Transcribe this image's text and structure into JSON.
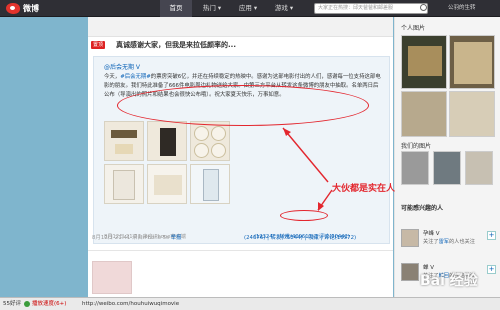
{
  "topbar": {
    "logo_text": "微博",
    "nav": [
      "首页",
      "热门 ▾",
      "应用 ▾",
      "游戏 ▾"
    ],
    "search_placeholder": "大家正在热搜：邱天爸爸和邮差服",
    "user_label": "公羽的生转"
  },
  "post": {
    "badge": "置顶",
    "title": "真诚感谢大家，但我是来拉低颜率的...",
    "quote": {
      "author": "@后会无期 V",
      "body_parts": [
        {
          "text": "今天，",
          "style": "plain"
        },
        {
          "text": "#后会无期#",
          "style": "lnk"
        },
        {
          "text": "的票房突破6亿，并还在持续稳定的热映中。感谢为这部电影付出的人们，感谢每一位支持这部电影的朋友。我们特此准备了666件电影周边礼物送给大家。由第三方平台从转发这条微博的朋友中抽取。名单两日后公布（导演出的照片和结果也会很快公布哦）。祝大家夏天快乐，万事如意。",
          "style": "plain"
        }
      ],
      "meta": "8月12日 21:31  来自iPhone客户端",
      "stats": "(12324) | 转发(409613) | 评论(90442)"
    },
    "meta": {
      "time": "8月12日 21:41",
      "source": "来自iPhone 5s",
      "report": "举报"
    },
    "stats": "(24076) | 转发(75544) | 收藏 | 评论(19572)"
  },
  "annotation": {
    "text": "大伙都是实在人"
  },
  "sidebar": {
    "photos_title": "个人图片",
    "related_title": "我们的图片",
    "interest_title": "可能感兴趣的人",
    "users": [
      {
        "name": "孕峰 V",
        "desc_prefix": "关注了",
        "desc_link": "雷军",
        "desc_suffix": "的人也关注"
      },
      {
        "name": "蝉 V",
        "desc_prefix": "关注了",
        "desc_link": "韩回",
        "desc_suffix": "的人也关注"
      }
    ]
  },
  "statusbar": {
    "left": "55好评",
    "speed_label": "播放速度(6+)",
    "url": "http://weibo.com/houhuiwuqimovie"
  },
  "watermark": "Bai 经验"
}
